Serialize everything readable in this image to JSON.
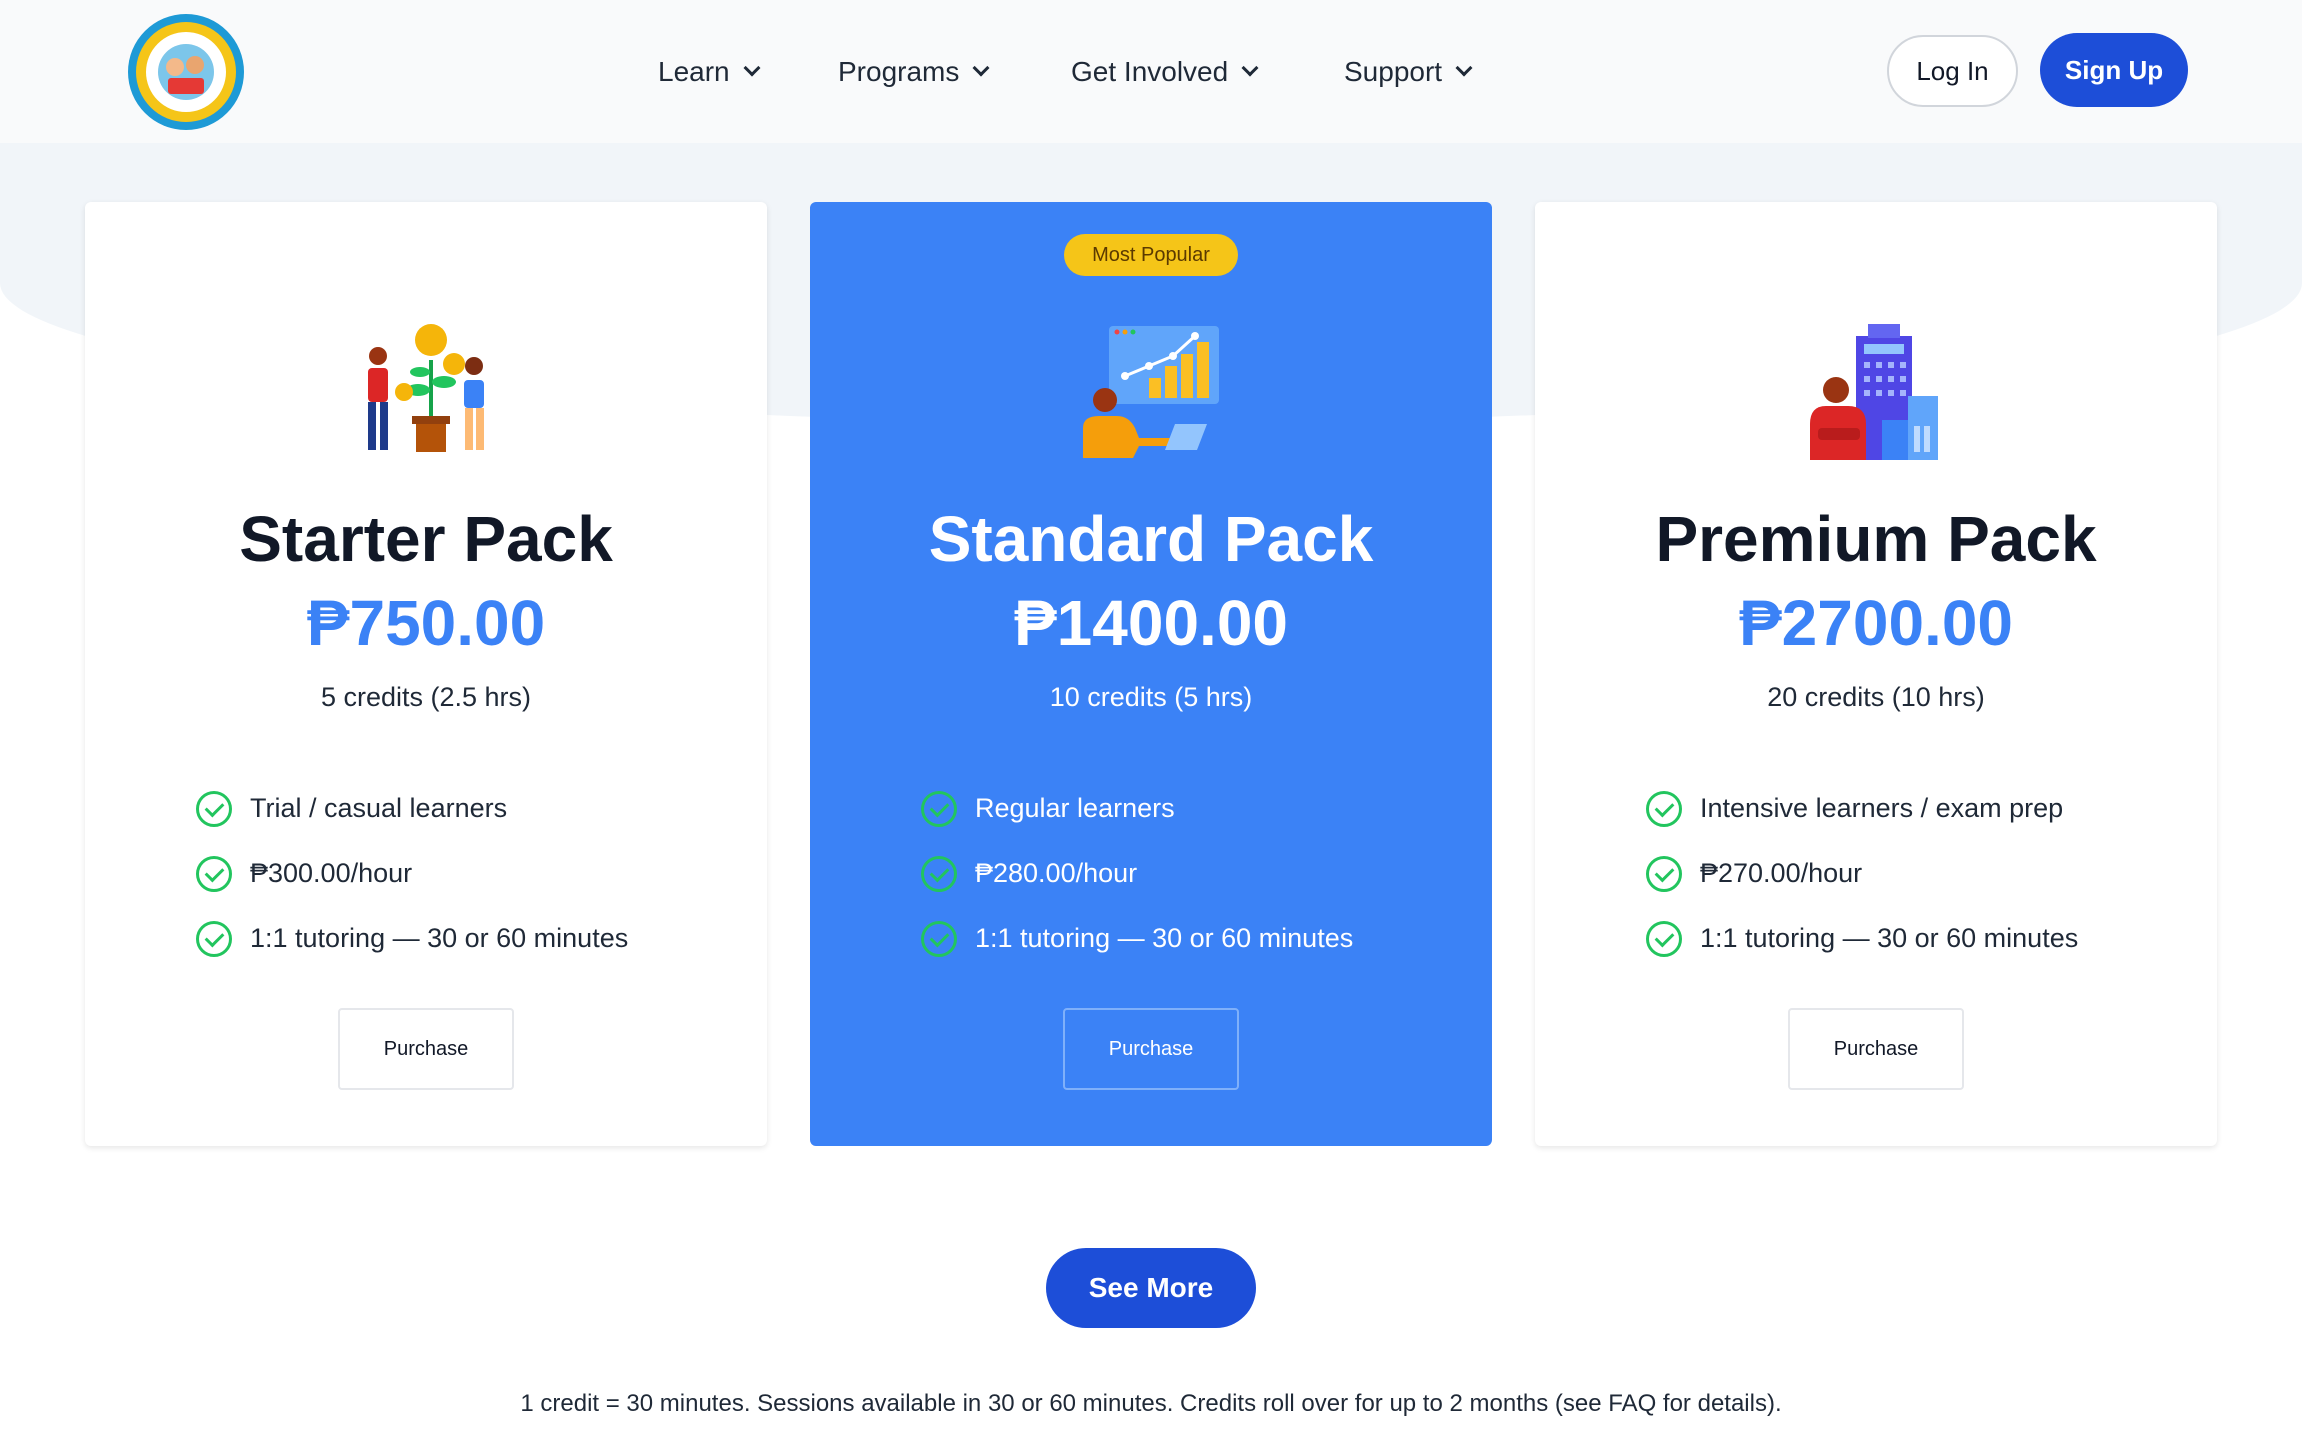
{
  "header": {
    "logo_icon": "school-logo-icon",
    "nav": [
      {
        "label": "Learn",
        "icon": "chevron-down-icon"
      },
      {
        "label": "Programs",
        "icon": "chevron-down-icon"
      },
      {
        "label": "Get Involved",
        "icon": "chevron-down-icon"
      },
      {
        "label": "Support",
        "icon": "chevron-down-icon"
      }
    ],
    "login_label": "Log In",
    "signup_label": "Sign Up"
  },
  "plans": [
    {
      "name": "Starter Pack",
      "price": "₱750.00",
      "credits": "5 credits (2.5 hrs)",
      "icon": "money-plant-illustration-icon",
      "features": [
        "Trial / casual learners",
        "₱300.00/hour",
        "1:1 tutoring — 30 or 60 minutes"
      ],
      "button_label": "Purchase"
    },
    {
      "name": "Standard Pack",
      "price": "₱1400.00",
      "credits": "10 credits (5 hrs)",
      "badge": "Most Popular",
      "icon": "growth-chart-illustration-icon",
      "features": [
        "Regular learners",
        "₱280.00/hour",
        "1:1 tutoring — 30 or 60 minutes"
      ],
      "button_label": "Purchase"
    },
    {
      "name": "Premium Pack",
      "price": "₱2700.00",
      "credits": "20 credits (10 hrs)",
      "icon": "business-building-illustration-icon",
      "features": [
        "Intensive learners / exam prep",
        "₱270.00/hour",
        "1:1 tutoring — 30 or 60 minutes"
      ],
      "button_label": "Purchase"
    }
  ],
  "see_more_label": "See More",
  "footnote": "1 credit = 30 minutes. Sessions available in 30 or 60 minutes. Credits roll over for up to 2 months (see FAQ for details).",
  "colors": {
    "primary": "#1d4ed8",
    "featured_card": "#3b82f6",
    "price": "#3b82f6",
    "badge": "#f5c518",
    "check": "#22c55e"
  }
}
